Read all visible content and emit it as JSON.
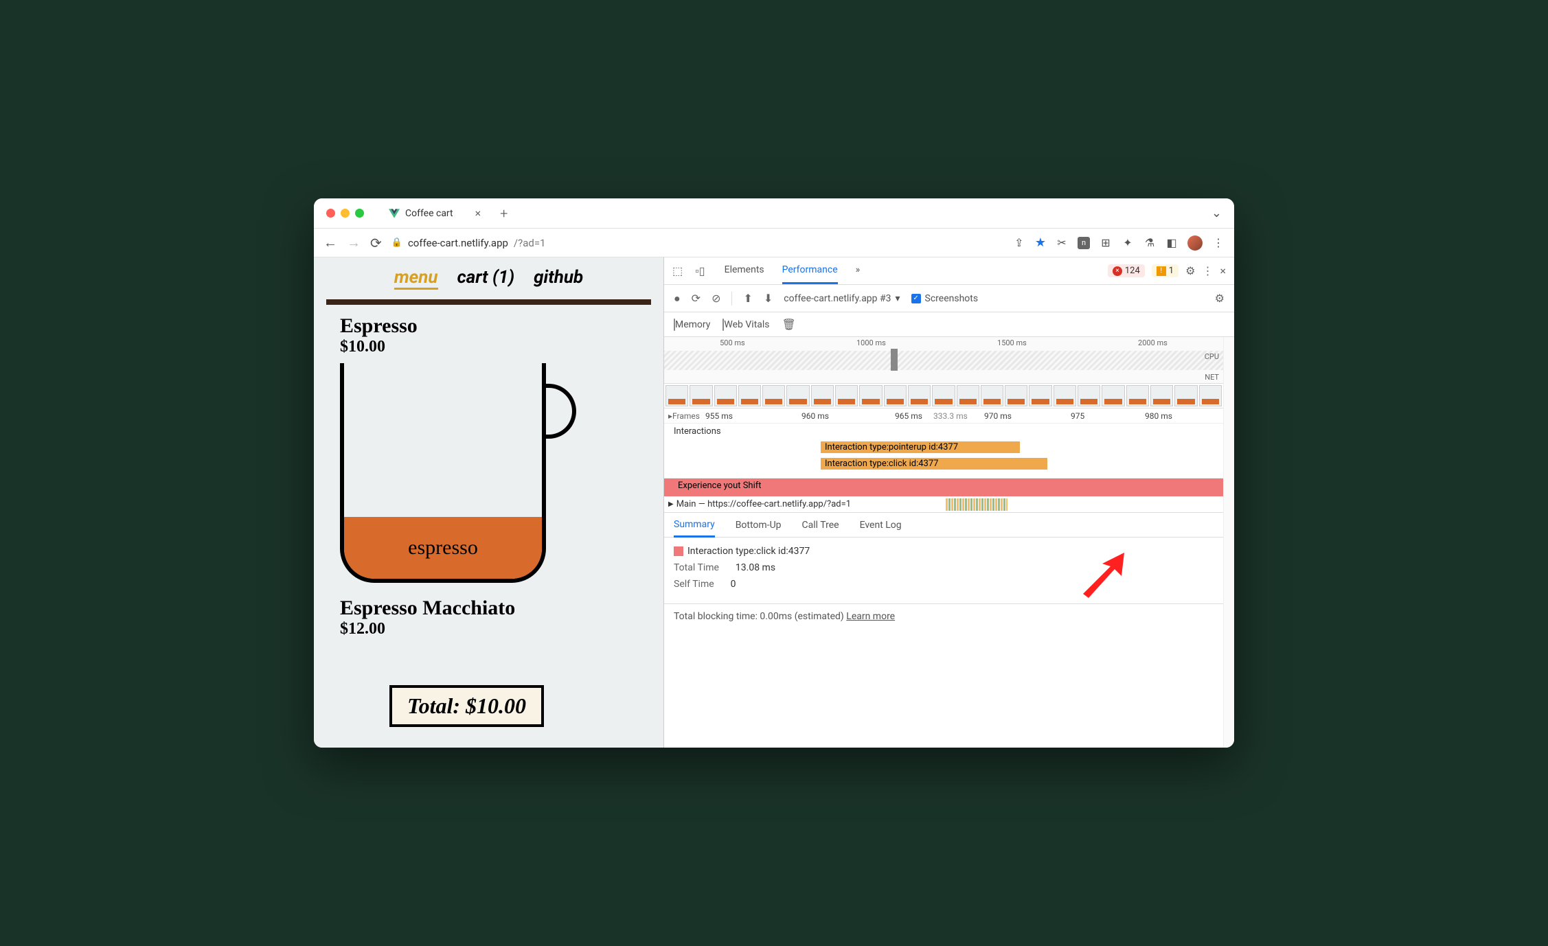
{
  "browser": {
    "tab_title": "Coffee cart",
    "url_host": "coffee-cart.netlify.app",
    "url_path": "/?ad=1"
  },
  "site": {
    "nav": {
      "menu": "menu",
      "cart": "cart (1)",
      "github": "github"
    },
    "product1": {
      "name": "Espresso",
      "price": "$10.00",
      "fill": "espresso"
    },
    "product2": {
      "name": "Espresso Macchiato",
      "price": "$12.00"
    },
    "total": "Total: $10.00"
  },
  "devtools": {
    "tabs": {
      "elements": "Elements",
      "performance": "Performance"
    },
    "errors": "124",
    "warnings": "1",
    "recording": "coffee-cart.netlify.app #3",
    "screenshots": "Screenshots",
    "memory": "Memory",
    "webvitals": "Web Vitals",
    "overview_ticks": [
      "500 ms",
      "1000 ms",
      "1500 ms",
      "2000 ms"
    ],
    "cpu": "CPU",
    "net": "NET",
    "timeline_frames": "Frames",
    "timeline": [
      "955 ms",
      "960 ms",
      "965 ms",
      "333.3 ms",
      "970 ms",
      "975",
      "980 ms"
    ],
    "interactions_label": "Interactions",
    "bar1": "Interaction type:pointerup id:4377",
    "bar2": "Interaction type:click id:4377",
    "experience": "Experience   yout Shift",
    "main": "Main — https://coffee-cart.netlify.app/?ad=1",
    "tabs2": {
      "summary": "Summary",
      "bottom": "Bottom-Up",
      "calltree": "Call Tree",
      "eventlog": "Event Log"
    },
    "summary": {
      "title": "Interaction type:click id:4377",
      "total_k": "Total Time",
      "total_v": "13.08 ms",
      "self_k": "Self Time",
      "self_v": "0"
    },
    "footer": "Total blocking time: 0.00ms (estimated)",
    "learn": "Learn more"
  }
}
